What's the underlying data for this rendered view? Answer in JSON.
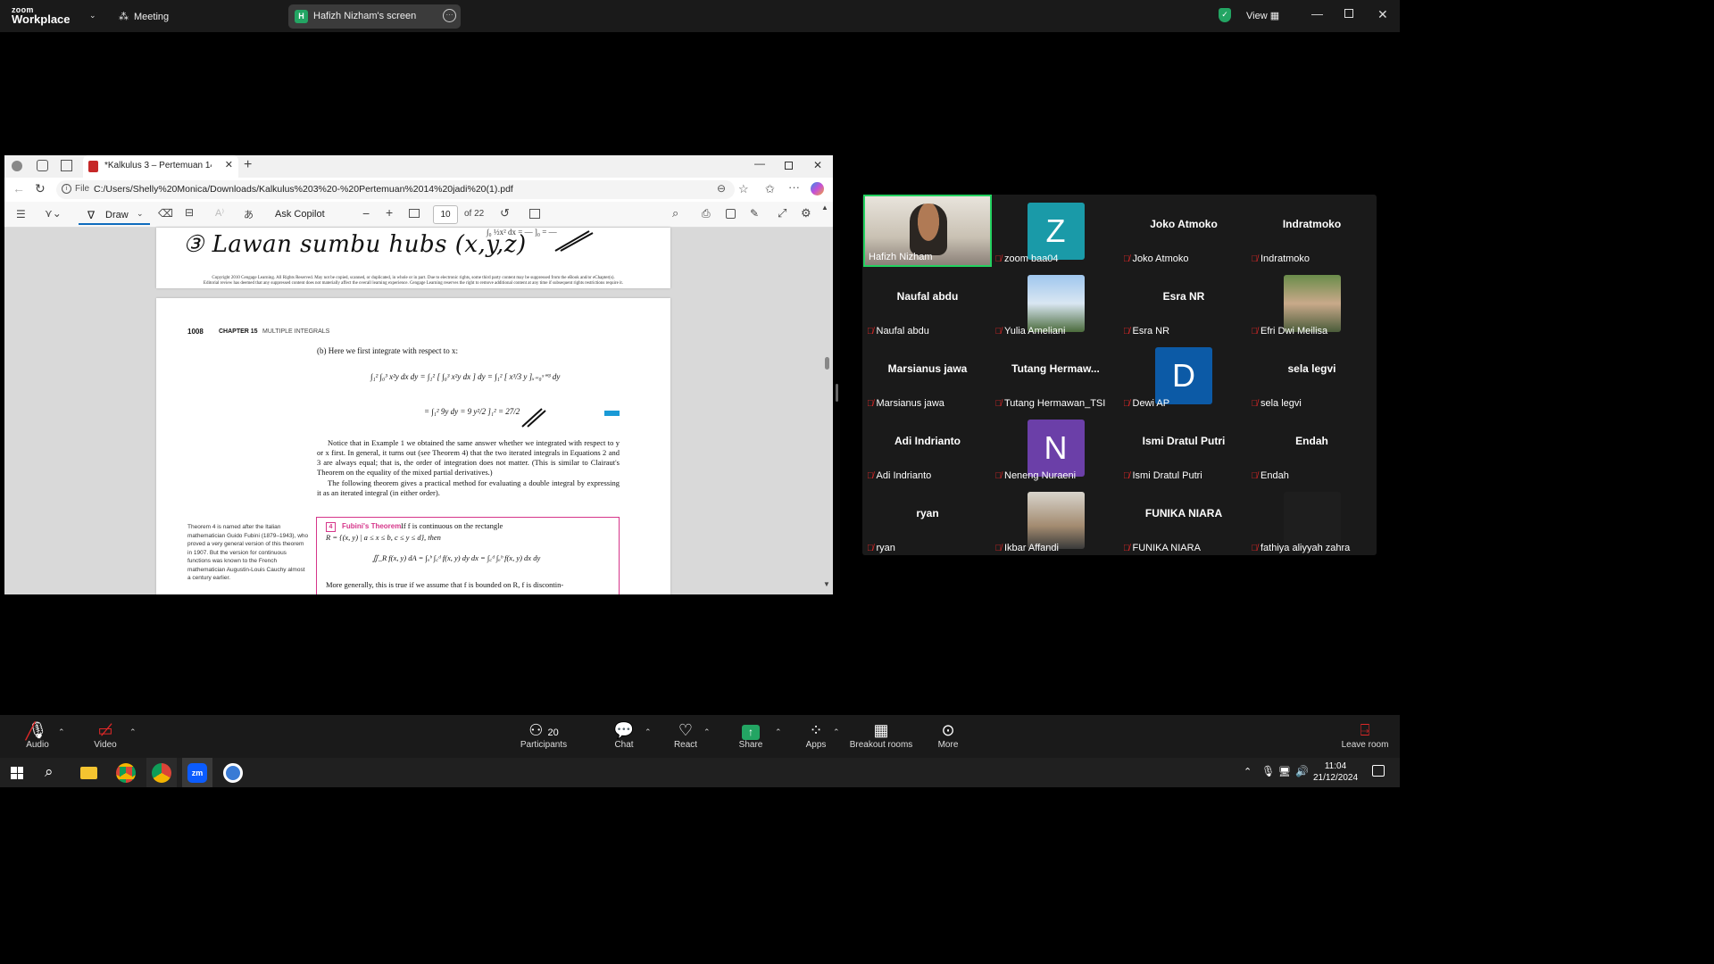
{
  "zoom": {
    "logo_small": "zoom",
    "logo_big": "Workplace",
    "meeting_label": "Meeting",
    "screen_pill": {
      "badge": "H",
      "label": "Hafizh Nizham's screen"
    },
    "view_label": "View"
  },
  "browser": {
    "tab_title": "*Kalkulus 3 – Pertemuan 14 jadi (",
    "url_prefix": "File",
    "url": "C:/Users/Shelly%20Monica/Downloads/Kalkulus%203%20-%20Pertemuan%2014%20jadi%20(1).pdf"
  },
  "pdf_toolbar": {
    "draw_label": "Draw",
    "copilot_label": "Ask Copilot",
    "page_value": "10",
    "page_total": "of 22"
  },
  "pdf_page_top": {
    "handwriting": "③ Lawan sumbu hubs (x,y,z)",
    "copyright": "Copyright 2010 Cengage Learning. All Rights Reserved. May not be copied, scanned, or duplicated, in whole or in part. Due to electronic rights, some third party content may be suppressed from the eBook and/or eChapter(s).",
    "copyright2": "Editorial review has deemed that any suppressed content does not materially affect the overall learning experience. Cengage Learning reserves the right to remove additional content at any time if subsequent rights restrictions require it."
  },
  "pdf_page": {
    "page_number": "1008",
    "chapter": "CHAPTER 15",
    "chapter_title": "MULTIPLE INTEGRALS",
    "part_b": "(b)  Here we first integrate with respect to x:",
    "eq1": "∫₁² ∫₀³ x²y dx dy = ∫₁² [ ∫₀³ x²y dx ] dy = ∫₁² [ x³/3 y ]ₓ₌₀ˣ⁼³ dy",
    "eq2": "= ∫₁² 9y dy = 9 y²/2 ]₁² = 27/2",
    "para1": "Notice that in Example 1 we obtained the same answer whether we integrated with respect to y or x first. In general, it turns out (see Theorem 4) that the two iterated integrals in Equations 2 and 3 are always equal; that is, the order of integration does not matter. (This is similar to Clairaut's Theorem on the equality of the mixed partial derivatives.)",
    "para2": "The following theorem gives a practical method for evaluating a double integral by expressing it as an iterated integral (in either order).",
    "sidenote": "Theorem 4 is named after the Italian mathematician Guido Fubini (1879–1943), who proved a very general version of this theorem in 1907. But the version for continuous functions was known to the French mathematician Augustin-Louis Cauchy almost a century earlier.",
    "theorem_num": "4",
    "theorem_name": "Fubini's Theorem",
    "theorem_text": "If f is continuous on the rectangle",
    "theorem_rect": "R = {(x, y) | a ≤ x ≤ b, c ≤ y ≤ d}, then",
    "theorem_eq": "∬_R f(x, y) dA = ∫ₐᵇ ∫꜀ᵈ f(x, y) dy dx = ∫꜀ᵈ ∫ₐᵇ f(x, y) dx dy",
    "more": "More generally, this is true if we assume that f is bounded on R, f is discontin-"
  },
  "participants": [
    {
      "label": "Hafizh Nizham",
      "type": "video",
      "active": true
    },
    {
      "label": "zoom baa04",
      "type": "avatar",
      "letter": "Z",
      "color": "#1a9aa8"
    },
    {
      "label": "Joko Atmoko",
      "type": "name",
      "name": "Joko Atmoko"
    },
    {
      "label": "Indratmoko",
      "type": "name",
      "name": "Indratmoko"
    },
    {
      "label": "Naufal abdu",
      "type": "name",
      "name": "Naufal abdu"
    },
    {
      "label": "Yulia Ameliani",
      "type": "photo"
    },
    {
      "label": "Esra NR",
      "type": "name",
      "name": "Esra NR"
    },
    {
      "label": "Efri Dwi Meilisa",
      "type": "photo"
    },
    {
      "label": "Marsianus jawa",
      "type": "name",
      "name": "Marsianus jawa"
    },
    {
      "label": "Tutang Hermawan_TSI",
      "type": "name",
      "name": "Tutang  Hermaw..."
    },
    {
      "label": "Dewi AP",
      "type": "avatar",
      "letter": "D",
      "color": "#0c5aa6"
    },
    {
      "label": "sela legvi",
      "type": "name",
      "name": "sela legvi"
    },
    {
      "label": "Adi Indrianto",
      "type": "name",
      "name": "Adi Indrianto"
    },
    {
      "label": "Neneng Nuraeni",
      "type": "avatar",
      "letter": "N",
      "color": "#6b3fa8"
    },
    {
      "label": "Ismi Dratul Putri",
      "type": "name",
      "name": "Ismi Dratul Putri"
    },
    {
      "label": "Endah",
      "type": "name",
      "name": "Endah"
    },
    {
      "label": "ryan",
      "type": "name",
      "name": "ryan"
    },
    {
      "label": "Ikbar Affandi",
      "type": "photo"
    },
    {
      "label": "FUNIKA NIARA",
      "type": "name",
      "name": "FUNIKA NIARA"
    },
    {
      "label": "fathiya aliyyah zahra",
      "type": "blank"
    }
  ],
  "bottombar": {
    "audio": "Audio",
    "video": "Video",
    "participants_count": "20",
    "participants": "Participants",
    "chat": "Chat",
    "react": "React",
    "share": "Share",
    "apps": "Apps",
    "breakout": "Breakout rooms",
    "more": "More",
    "leave": "Leave room"
  },
  "taskbar": {
    "time": "11:04",
    "date": "21/12/2024"
  },
  "colors": {
    "accent_green": "#23a563",
    "mute_red": "#e02828",
    "active_speaker": "#23d160",
    "theorem_pink": "#d6358a"
  }
}
